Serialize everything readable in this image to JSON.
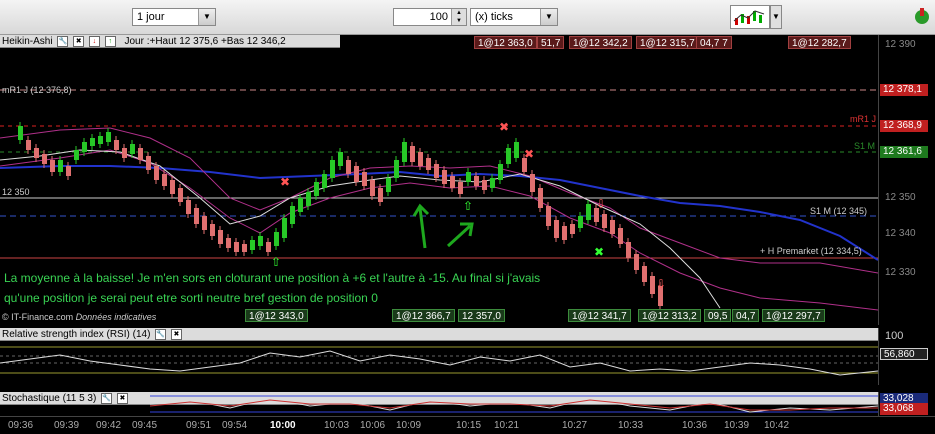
{
  "toolbar": {
    "period": "1 jour",
    "count": "100",
    "unit": "(x) ticks"
  },
  "main": {
    "indicator": "Heikin-Ashi",
    "info": "Jour :+Haut 12 375,6 +Bas 12 346,2",
    "ma_label": "mR1 J (12 376,8)",
    "level_12350": "12 350",
    "mR1_label": "mR1 J",
    "s1_label": "S1 M",
    "s1m_label": "S1 M (12 345)",
    "premarket": "+ H Premarket (12 334,5)",
    "copyright": "© IT-Finance.com",
    "donnees": "Données indicatives",
    "comment_line1": "La moyenne à la baisse! Je m'en sors en cloturant une position à +6 et l'autre à -15. Au final si j'avais",
    "comment_line2": "qu'une position je serai peut etre sorti neutre bref gestion de position 0"
  },
  "orders_top": [
    "1@12 363,0",
    "51,7",
    "1@12 342,2",
    "1@12 315,7",
    "04,7 7",
    "1@12 282,7"
  ],
  "orders_bottom": [
    "1@12 343,0",
    "1@12 366,7",
    "12 357,0",
    "1@12 341,7",
    "1@12 313,2",
    "09,5",
    "04,7",
    "1@12 297,7"
  ],
  "price_axis": {
    "ticks": [
      "12 390",
      "12 350",
      "12 340",
      "12 330"
    ],
    "tags": [
      {
        "text": "12 378,1",
        "color": "#c02020"
      },
      {
        "text": "12 368,9",
        "color": "#c02020"
      },
      {
        "text": "12 361,6",
        "color": "#1e7a1e"
      }
    ]
  },
  "rsi": {
    "label": "Relative strength index (RSI) (14)",
    "axis_top": "100",
    "value": "56,860"
  },
  "stoch": {
    "label": "Stochastique (11 5 3)",
    "value1": "33,068",
    "value2": "33,028"
  },
  "time_axis": [
    "09:36",
    "09:39",
    "09:42",
    "09:45",
    "09:51",
    "09:54",
    "10:00",
    "10:03",
    "10:06",
    "10:09",
    "10:15",
    "10:21",
    "10:27",
    "10:33",
    "10:36",
    "10:39",
    "10:42"
  ]
}
